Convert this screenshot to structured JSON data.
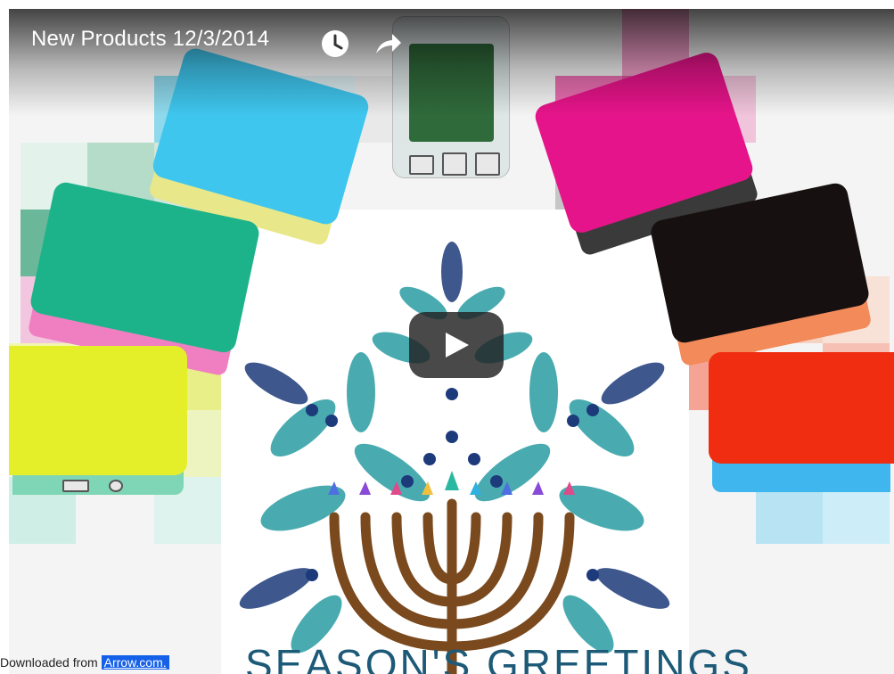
{
  "video": {
    "title": "New Products 12/3/2014",
    "icons": [
      "watch-later-icon",
      "share-icon",
      "play-icon"
    ],
    "play_button_label": "Play"
  },
  "frame": {
    "greeting_text": "SEASON'S GREETINGS",
    "case_colors": {
      "blue": "#3fc6ee",
      "clear": "#d8e0e0",
      "magenta": "#e6148a",
      "green": "#1db38a",
      "black": "#161010",
      "yellow": "#e4ef2a",
      "red": "#f02d10"
    },
    "menorah_color": "#7a4a1e",
    "leaf_colors": [
      "#2a9da3",
      "#1d3a7a"
    ]
  },
  "watermark": {
    "prefix": "Downloaded from",
    "link_text": "Arrow.com."
  }
}
